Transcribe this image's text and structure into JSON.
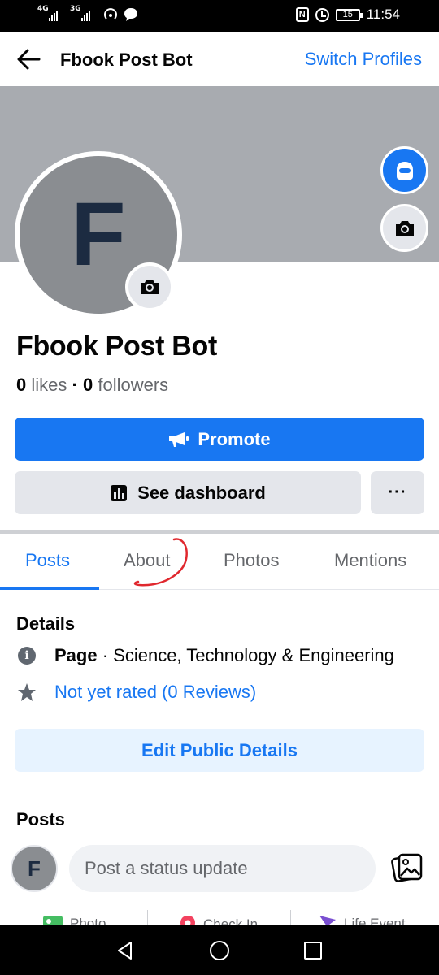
{
  "status_bar": {
    "sim1_network": "4G",
    "sim2_network": "3G",
    "battery": "15",
    "time": "11:54"
  },
  "header": {
    "title": "Fbook Post Bot",
    "switch_profiles": "Switch Profiles"
  },
  "profile": {
    "initial": "F",
    "name": "Fbook Post Bot",
    "likes_count": "0",
    "likes_label": "likes",
    "separator": "·",
    "followers_count": "0",
    "followers_label": "followers"
  },
  "buttons": {
    "promote": "Promote",
    "dashboard": "See dashboard",
    "more": "···"
  },
  "tabs": [
    {
      "label": "Posts",
      "active": true
    },
    {
      "label": "About",
      "active": false
    },
    {
      "label": "Photos",
      "active": false
    },
    {
      "label": "Mentions",
      "active": false
    }
  ],
  "details": {
    "title": "Details",
    "page_label": "Page",
    "page_sep": " · ",
    "category": "Science, Technology & Engineering",
    "rating": "Not yet rated (0 Reviews)",
    "edit_button": "Edit Public Details"
  },
  "posts": {
    "title": "Posts",
    "avatar_initial": "F",
    "placeholder": "Post a status update",
    "actions": [
      "Photo",
      "Check In",
      "Life Event"
    ]
  },
  "colors": {
    "accent": "#1877f2",
    "annotation": "#e0282e"
  }
}
